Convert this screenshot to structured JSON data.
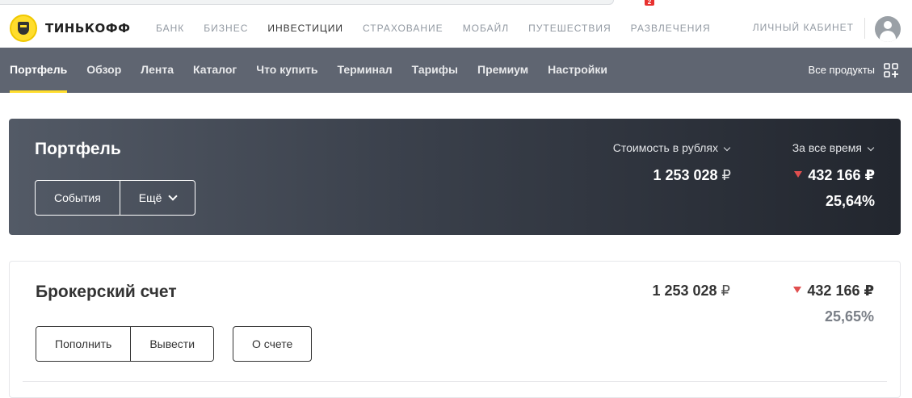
{
  "browser": {
    "badge_count": "2"
  },
  "header": {
    "brand": "ТИНЬКОФФ",
    "nav": [
      "БАНК",
      "БИЗНЕС",
      "ИНВЕСТИЦИИ",
      "СТРАХОВАНИЕ",
      "МОБАЙЛ",
      "ПУТЕШЕСТВИЯ",
      "РАЗВЛЕЧЕНИЯ"
    ],
    "active_nav": "ИНВЕСТИЦИИ",
    "cabinet": "ЛИЧНЫЙ КАБИНЕТ"
  },
  "subnav": {
    "items": [
      "Портфель",
      "Обзор",
      "Лента",
      "Каталог",
      "Что купить",
      "Терминал",
      "Тарифы",
      "Премиум",
      "Настройки"
    ],
    "active": "Портфель",
    "all_products": "Все продукты"
  },
  "portfolio": {
    "title": "Портфель",
    "events_button": "События",
    "more_button": "Ещё",
    "cost_label": "Стоимость в рублях",
    "period_label": "За все время",
    "value": "1 253 028",
    "currency": "₽",
    "change": "432 166 ₽",
    "percent": "25,64%"
  },
  "account": {
    "title": "Брокерский счет",
    "topup_button": "Пополнить",
    "withdraw_button": "Вывести",
    "about_button": "О счете",
    "value": "1 253 028",
    "currency": "₽",
    "change": "432 166 ₽",
    "percent": "25,65%"
  },
  "colors": {
    "accent": "#ffdd2d",
    "subnav_bg": "#5f6571",
    "negative": "#e04f4f"
  }
}
